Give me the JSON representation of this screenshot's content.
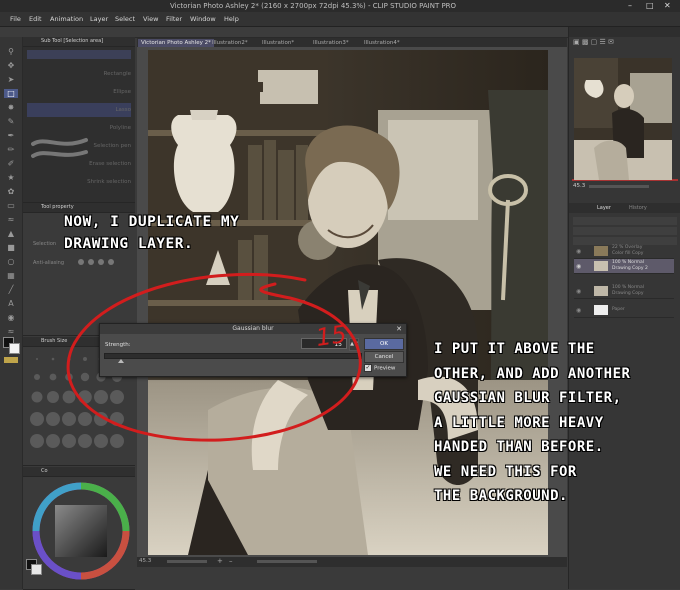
{
  "window": {
    "title": "Victorian Photo Ashley 2* (2160 x 2700px 72dpi 45.3%)  - CLIP STUDIO PAINT PRO"
  },
  "menu": [
    "File",
    "Edit",
    "Animation",
    "Layer",
    "Select",
    "View",
    "Filter",
    "Window",
    "Help"
  ],
  "left_panel": {
    "sub_tool_title": "Sub Tool [Selection area]",
    "subtools": [
      "Rectangle",
      "Ellipse",
      "Lasso",
      "Polyline",
      "Selection pen",
      "Erase selection",
      "Shrink selection"
    ],
    "tool_property_title": "Tool property",
    "tool_property_items": [
      "Selection",
      "Anti-aliasing"
    ],
    "brush_size_title": "Brush Size",
    "color_title": "Co"
  },
  "canvas_tabs": [
    "Victorian Photo Ashley 2*",
    "Illustration2*",
    "Illustration*",
    "Illustration3*",
    "Illustration4*"
  ],
  "status": {
    "zoom": "45.3"
  },
  "navigator": {
    "zoom": "45.3"
  },
  "layers": {
    "tabs": [
      "Layer",
      "History"
    ],
    "items": [
      {
        "name": "22 % Overlay",
        "sub": "Color fill Copy"
      },
      {
        "name": "100 % Normal",
        "sub": "Drawing Copy 2"
      },
      {
        "name": "100 % Normal",
        "sub": "Drawing Copy"
      },
      {
        "name": "",
        "sub": "Paper"
      }
    ]
  },
  "dialog": {
    "title": "Gaussian blur",
    "strength_label": "Strength:",
    "strength_value": "15",
    "ok_label": "OK",
    "cancel_label": "Cancel",
    "preview_label": "Preview",
    "preview_checked": true
  },
  "annotations": {
    "note1": [
      "NOW, I DUPLICATE MY",
      "DRAWING LAYER."
    ],
    "note2": [
      "I PUT IT ABOVE THE",
      "OTHER, AND ADD ANOTHER",
      "GAUSSIAN BLUR FILTER,",
      "A LITTLE MORE HEAVY",
      "HANDED THAN BEFORE.",
      "WE NEED THIS FOR",
      "THE BACKGROUND."
    ],
    "handwritten_value": "15"
  },
  "colors": {
    "annotation_red": "#d21d1d",
    "ok_button": "#5a6aa0",
    "panel_dark": "#3a3a3a"
  }
}
